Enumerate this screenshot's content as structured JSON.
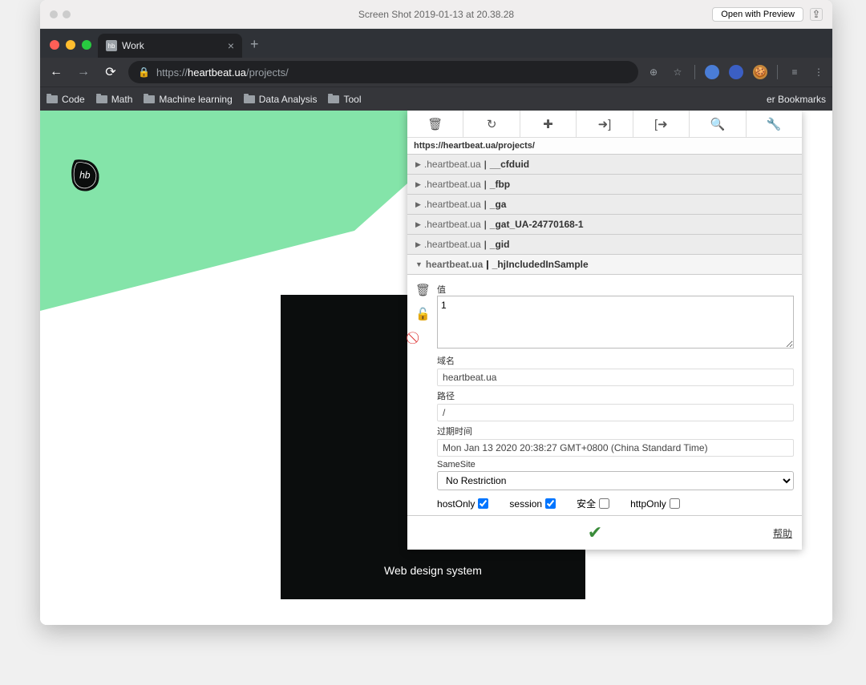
{
  "mac": {
    "title": "Screen Shot 2019-01-13 at 20.38.28",
    "open_preview": "Open with Preview"
  },
  "chrome": {
    "tab_title": "Work",
    "url_secure": "https://",
    "url_domain": "heartbeat.ua",
    "url_path": "/projects/",
    "bookmarks": [
      "Code",
      "Math",
      "Machine learning",
      "Data Analysis",
      "Tool"
    ],
    "other_bookmarks": "er Bookmarks"
  },
  "page": {
    "card_text": "Web design system"
  },
  "panel": {
    "url": "https://heartbeat.ua/projects/",
    "cookies": [
      {
        "domain": ".heartbeat.ua",
        "name": "__cfduid"
      },
      {
        "domain": ".heartbeat.ua",
        "name": "_fbp"
      },
      {
        "domain": ".heartbeat.ua",
        "name": "_ga"
      },
      {
        "domain": ".heartbeat.ua",
        "name": "_gat_UA-24770168-1"
      },
      {
        "domain": ".heartbeat.ua",
        "name": "_gid"
      }
    ],
    "expanded": {
      "domain": "heartbeat.ua",
      "name": "_hjIncludedInSample"
    },
    "labels": {
      "value": "值",
      "domain": "域名",
      "path": "路径",
      "expires": "过期时间",
      "samesite": "SameSite",
      "hostonly": "hostOnly",
      "session": "session",
      "secure": "安全",
      "httponly": "httpOnly"
    },
    "values": {
      "value": "1",
      "domain": "heartbeat.ua",
      "path": "/",
      "expires": "Mon Jan 13 2020 20:38:27 GMT+0800 (China Standard Time)",
      "samesite": "No Restriction",
      "hostonly": true,
      "session": true,
      "secure": false,
      "httponly": false
    },
    "help": "帮助"
  }
}
